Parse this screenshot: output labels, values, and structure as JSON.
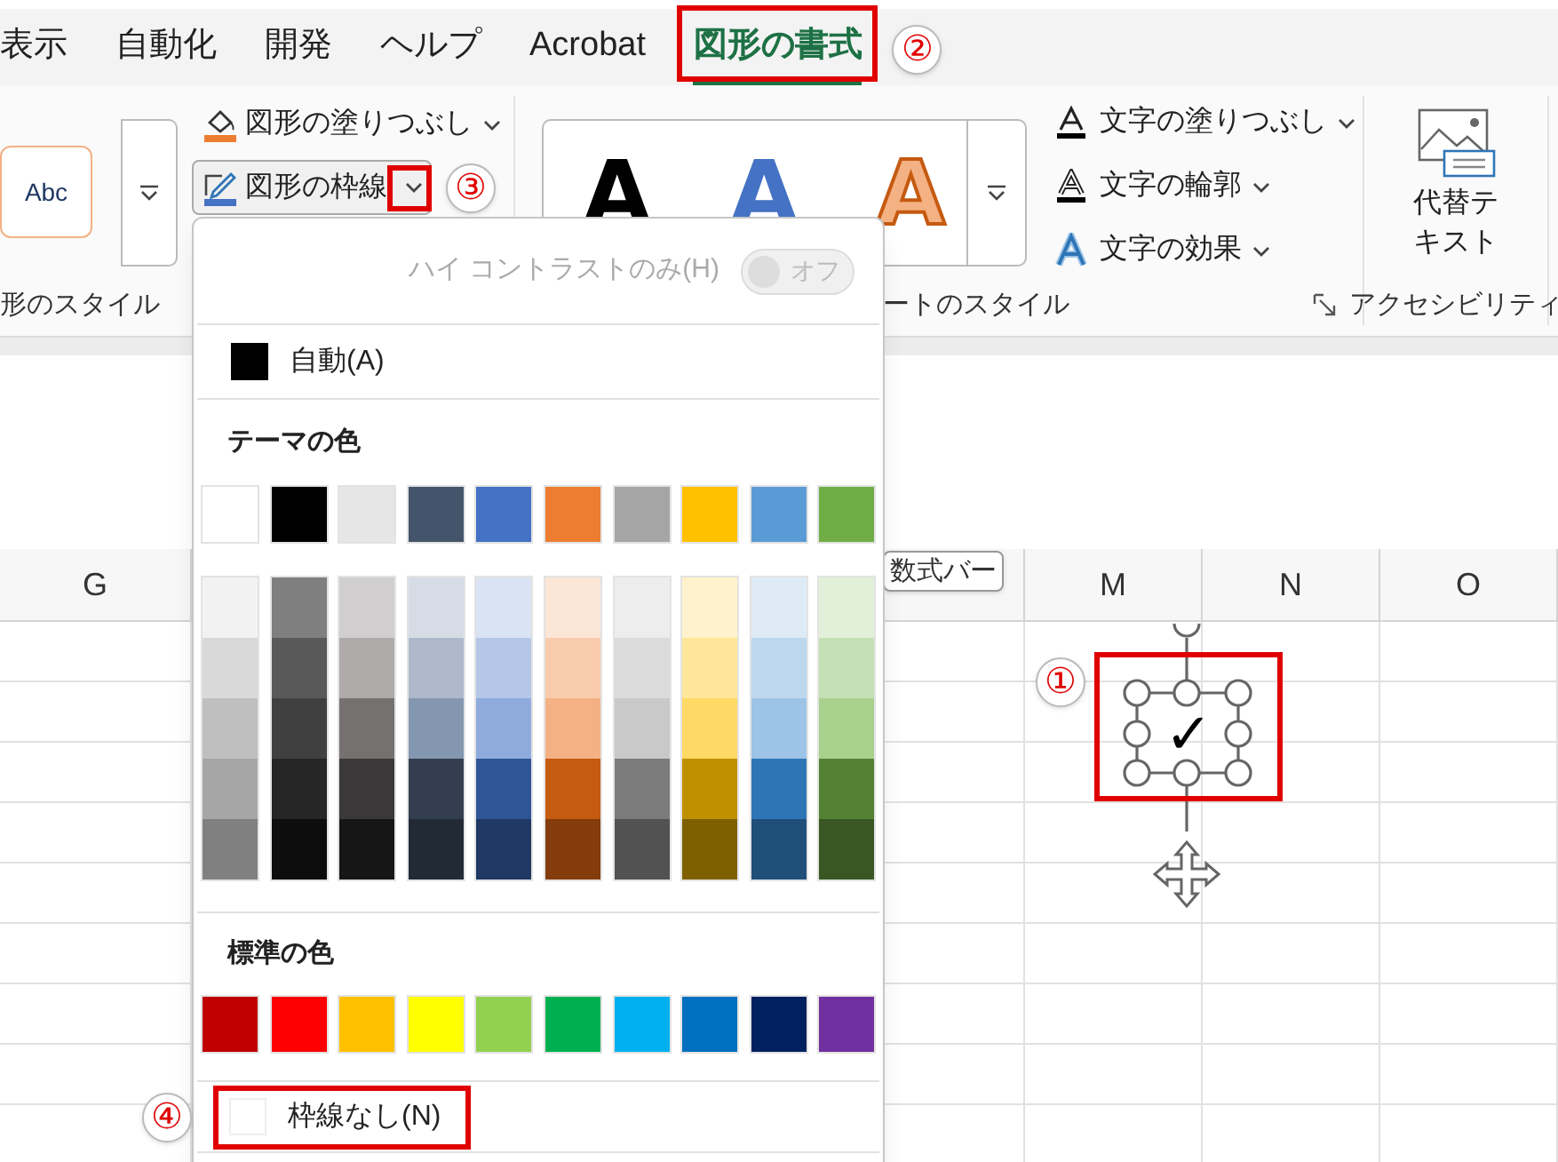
{
  "tabs": [
    {
      "label": "表示",
      "selected": false
    },
    {
      "label": "自動化",
      "selected": false
    },
    {
      "label": "開発",
      "selected": false
    },
    {
      "label": "ヘルプ",
      "selected": false
    },
    {
      "label": "Acrobat",
      "selected": false
    },
    {
      "label": "図形の書式",
      "selected": true,
      "highlighted": true,
      "callout": "②"
    }
  ],
  "ribbon": {
    "shape_styles": {
      "sample": "Abc",
      "label": "形のスタイル"
    },
    "shape_fill": {
      "label": "図形の塗りつぶし"
    },
    "shape_outline": {
      "label": "図形の枠線",
      "expanded": true,
      "highlighted": true,
      "callout": "③"
    },
    "wordart_styles": {
      "samples": [
        {
          "kind": "solid",
          "text": "A"
        },
        {
          "kind": "blue",
          "text": "A"
        },
        {
          "kind": "outline",
          "text": "A"
        }
      ],
      "label": "ートのスタイル"
    },
    "text_buttons": [
      {
        "kind": "fill",
        "label": "文字の塗りつぶし"
      },
      {
        "kind": "outline",
        "label": "文字の輪郭"
      },
      {
        "kind": "effects",
        "label": "文字の効果"
      }
    ],
    "alt_text": {
      "label": "代替テキスト",
      "group_label": "アクセシビリティ"
    }
  },
  "outline_menu": {
    "high_contrast": {
      "label": "ハイ コントラストのみ(H)",
      "toggle_text": "オフ",
      "on": false,
      "disabled": true
    },
    "automatic": {
      "label": "自動(A)",
      "color": "#000000"
    },
    "theme_heading": "テーマの色",
    "theme_colors": [
      {
        "color": "#ffffff"
      },
      {
        "color": "#000000"
      },
      {
        "color": "#e7e6e6"
      },
      {
        "color": "#44546a"
      },
      {
        "color": "#4472c4"
      },
      {
        "color": "#ed7d31"
      },
      {
        "color": "#a5a5a5"
      },
      {
        "color": "#ffc000"
      },
      {
        "color": "#5b9bd5"
      },
      {
        "color": "#70ad47"
      }
    ],
    "theme_shades": [
      [
        {
          "color": "#f2f2f2"
        },
        {
          "color": "#d9d9d9"
        },
        {
          "color": "#bfbfbf"
        },
        {
          "color": "#a6a6a6"
        },
        {
          "color": "#808080"
        }
      ],
      [
        {
          "color": "#7f7f7f"
        },
        {
          "color": "#595959"
        },
        {
          "color": "#404040"
        },
        {
          "color": "#262626"
        },
        {
          "color": "#0d0d0d"
        }
      ],
      [
        {
          "color": "#d0cece"
        },
        {
          "color": "#aeaaaa"
        },
        {
          "color": "#757171"
        },
        {
          "color": "#3a3838"
        },
        {
          "color": "#171616"
        }
      ],
      [
        {
          "color": "#d6dce5"
        },
        {
          "color": "#adb9ca"
        },
        {
          "color": "#8497b0"
        },
        {
          "color": "#333f50"
        },
        {
          "color": "#222a35"
        }
      ],
      [
        {
          "color": "#dae3f3"
        },
        {
          "color": "#b4c7e7"
        },
        {
          "color": "#8faadc"
        },
        {
          "color": "#2f5597"
        },
        {
          "color": "#1f3864"
        }
      ],
      [
        {
          "color": "#fbe5d6"
        },
        {
          "color": "#f8cbad"
        },
        {
          "color": "#f4b183"
        },
        {
          "color": "#c55a11"
        },
        {
          "color": "#843c0c"
        }
      ],
      [
        {
          "color": "#ededed"
        },
        {
          "color": "#dbdbdb"
        },
        {
          "color": "#c9c9c9"
        },
        {
          "color": "#7b7b7b"
        },
        {
          "color": "#525252"
        }
      ],
      [
        {
          "color": "#fff2cc"
        },
        {
          "color": "#ffe699"
        },
        {
          "color": "#ffd966"
        },
        {
          "color": "#bf9000"
        },
        {
          "color": "#7f6000"
        }
      ],
      [
        {
          "color": "#deebf7"
        },
        {
          "color": "#bdd7ee"
        },
        {
          "color": "#9dc3e6"
        },
        {
          "color": "#2e75b6"
        },
        {
          "color": "#1f4e79"
        }
      ],
      [
        {
          "color": "#e2f0d9"
        },
        {
          "color": "#c5e0b4"
        },
        {
          "color": "#a9d18e"
        },
        {
          "color": "#548235"
        },
        {
          "color": "#385723"
        }
      ]
    ],
    "standard_heading": "標準の色",
    "standard_colors": [
      {
        "color": "#c00000"
      },
      {
        "color": "#ff0000"
      },
      {
        "color": "#ffc000"
      },
      {
        "color": "#ffff00"
      },
      {
        "color": "#92d050"
      },
      {
        "color": "#00b050"
      },
      {
        "color": "#00b0f0"
      },
      {
        "color": "#0070c0"
      },
      {
        "color": "#002060"
      },
      {
        "color": "#7030a0"
      }
    ],
    "no_outline": {
      "label": "枠線なし(N)",
      "highlighted": true,
      "callout": "④"
    }
  },
  "tooltip": "数式バー",
  "columns": [
    "G",
    "",
    "",
    "M",
    "N",
    "O"
  ],
  "shape": {
    "text": "✓",
    "selected": true,
    "highlighted": true,
    "callout": "①"
  }
}
